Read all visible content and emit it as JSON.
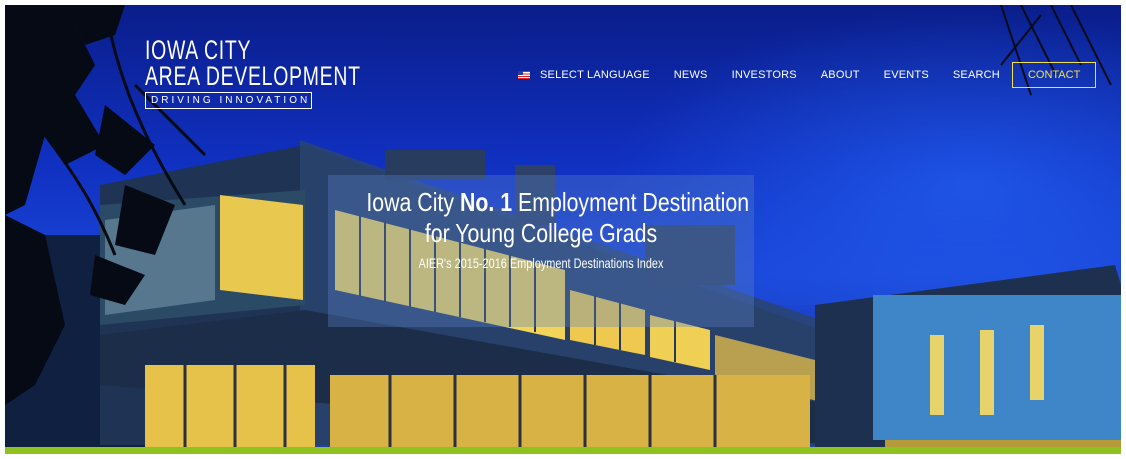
{
  "logo": {
    "line1": "IOWA CITY",
    "line2": "AREA DEVELOPMENT",
    "tagline": "DRIVING INNOVATION"
  },
  "nav": {
    "flag_icon": "us-flag-icon",
    "items": [
      "SELECT LANGUAGE",
      "NEWS",
      "INVESTORS",
      "ABOUT",
      "EVENTS",
      "SEARCH"
    ],
    "contact": "CONTACT"
  },
  "hero": {
    "title_pre": "Iowa City ",
    "title_bold": "No. 1",
    "title_post": " Employment Destination",
    "title_line2": "for Young College Grads",
    "subtitle": "AIER's 2015-2016 Employment Destinations Index"
  },
  "colors": {
    "sky": "#1030c0",
    "accent_green": "#8ec21e",
    "contact_yellow": "#f5e14a"
  }
}
